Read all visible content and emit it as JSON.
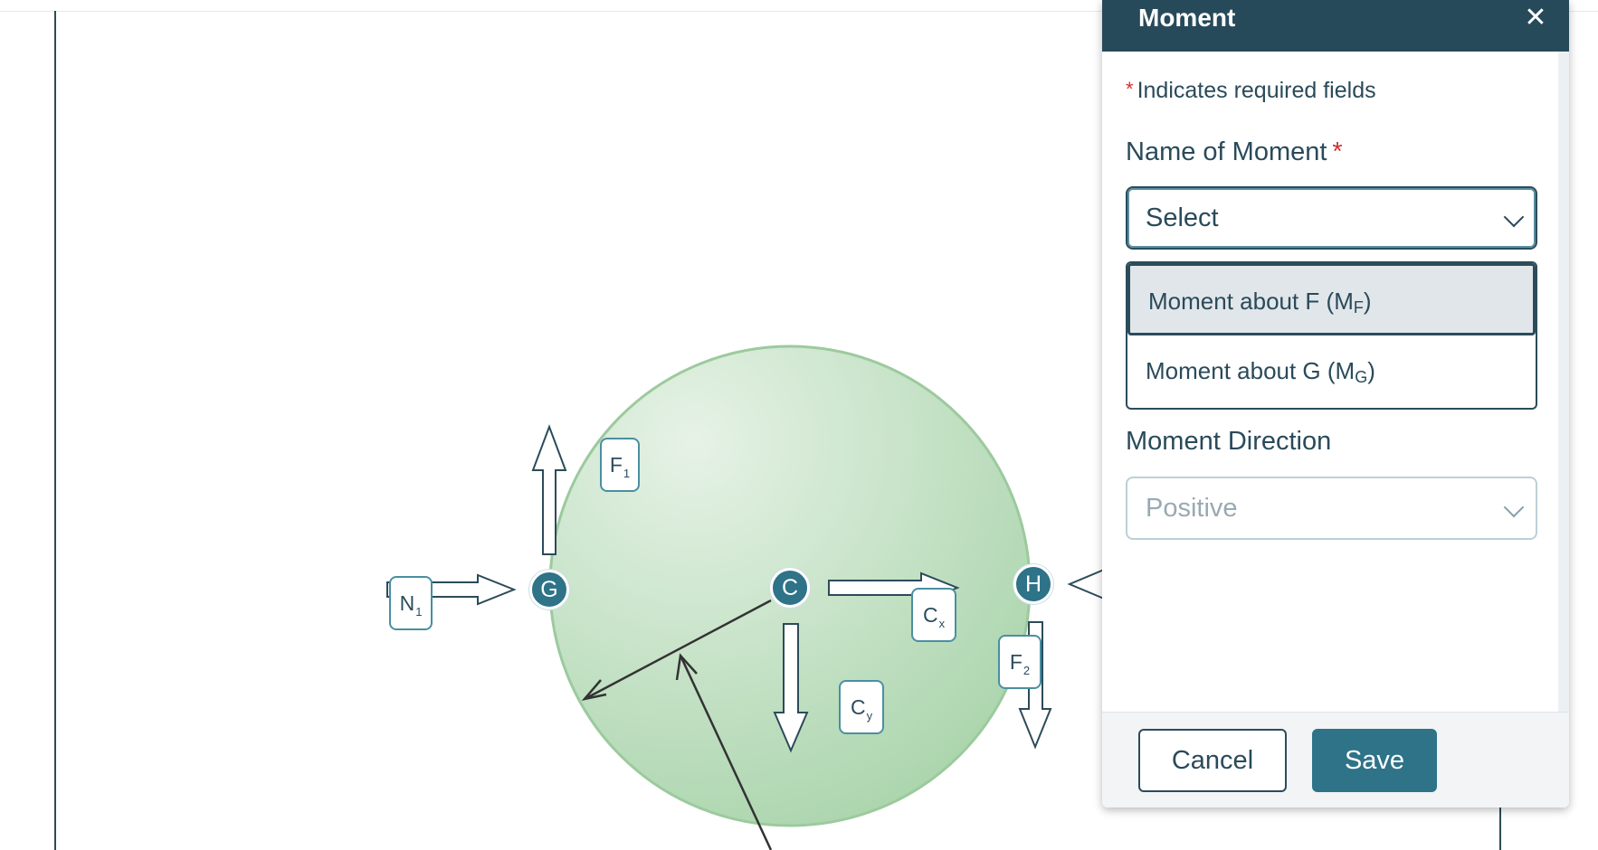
{
  "diagram": {
    "nodes": {
      "g": "G",
      "c": "C",
      "h": "H"
    },
    "labels": {
      "n1": {
        "main": "N",
        "sub": "1"
      },
      "f1": {
        "main": "F",
        "sub": "1"
      },
      "cx": {
        "main": "C",
        "sub": "x"
      },
      "cy": {
        "main": "C",
        "sub": "y"
      },
      "f2": {
        "main": "F",
        "sub": "2"
      }
    },
    "colors": {
      "disk": "#b7dcb8",
      "node": "#2e7388",
      "accent": "#274a5a"
    }
  },
  "dialog": {
    "title": "Moment",
    "close_icon": "close-icon",
    "required_star": "*",
    "required_note": "Indicates required fields",
    "name_label": "Name of Moment",
    "name_select_value": "Select",
    "options": [
      {
        "text": "Moment about F (M",
        "sub": "F",
        "suffix": ")",
        "highlighted": true
      },
      {
        "text": "Moment about G (M",
        "sub": "G",
        "suffix": ")",
        "highlighted": false
      }
    ],
    "direction_label": "Moment Direction",
    "direction_value": "Positive",
    "cancel_label": "Cancel",
    "save_label": "Save"
  }
}
